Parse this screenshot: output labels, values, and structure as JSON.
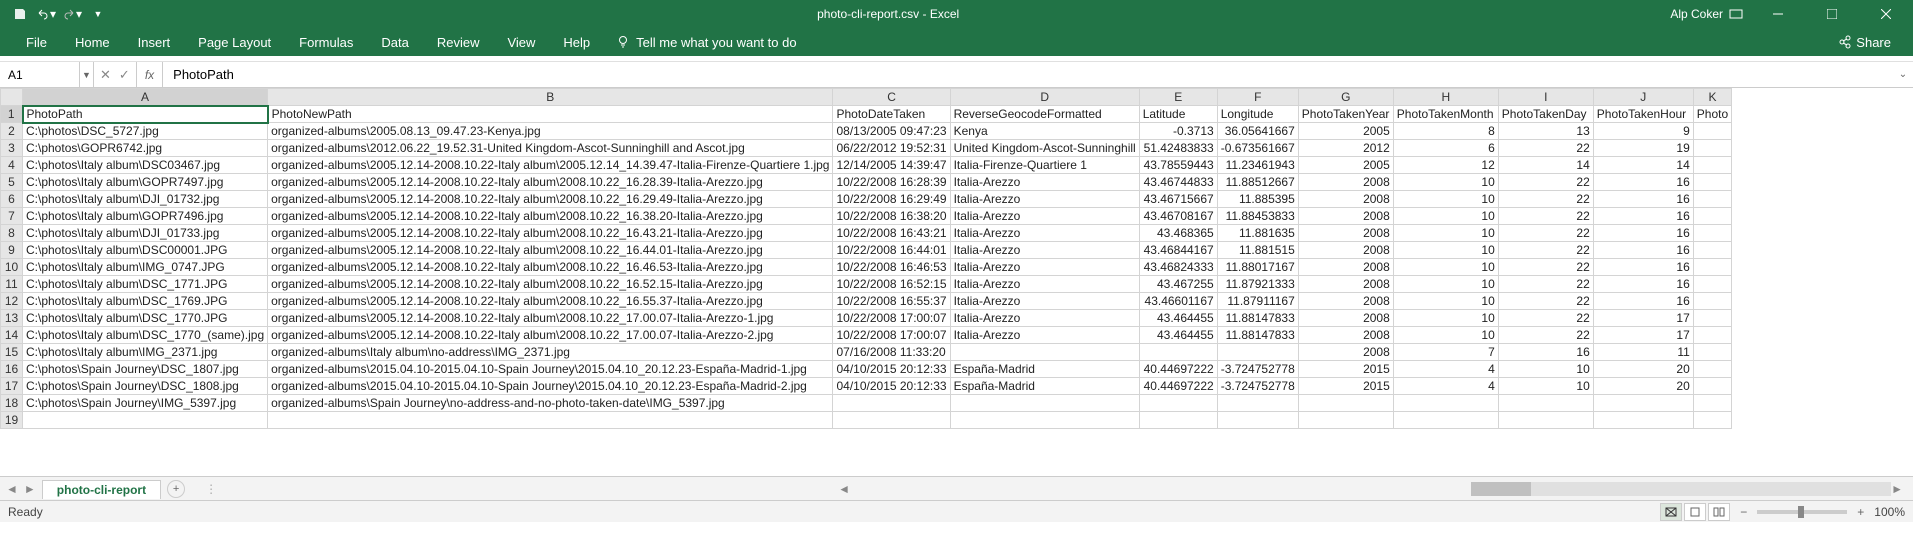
{
  "title": "photo-cli-report.csv - Excel",
  "user": "Alp Coker",
  "ribbon": {
    "file": "File",
    "home": "Home",
    "insert": "Insert",
    "pagelayout": "Page Layout",
    "formulas": "Formulas",
    "data": "Data",
    "review": "Review",
    "view": "View",
    "help": "Help",
    "tellme": "Tell me what you want to do",
    "share": "Share"
  },
  "namebox": "A1",
  "formula": "PhotoPath",
  "sheet_name": "photo-cli-report",
  "status": "Ready",
  "zoom": "100%",
  "columns": [
    "",
    "A",
    "B",
    "C",
    "D",
    "E",
    "F",
    "G",
    "H",
    "I",
    "J",
    "K"
  ],
  "headers": [
    "PhotoPath",
    "PhotoNewPath",
    "PhotoDateTaken",
    "ReverseGeocodeFormatted",
    "Latitude",
    "Longitude",
    "PhotoTakenYear",
    "PhotoTakenMonth",
    "PhotoTakenDay",
    "PhotoTakenHour",
    "Photo"
  ],
  "rows": [
    [
      "C:\\photos\\DSC_5727.jpg",
      "organized-albums\\2005.08.13_09.47.23-Kenya.jpg",
      "08/13/2005 09:47:23",
      "Kenya",
      "-0.3713",
      "36.05641667",
      "2005",
      "8",
      "13",
      "9",
      ""
    ],
    [
      "C:\\photos\\GOPR6742.jpg",
      "organized-albums\\2012.06.22_19.52.31-United Kingdom-Ascot-Sunninghill and Ascot.jpg",
      "06/22/2012 19:52:31",
      "United Kingdom-Ascot-Sunninghill",
      "51.42483833",
      "-0.673561667",
      "2012",
      "6",
      "22",
      "19",
      ""
    ],
    [
      "C:\\photos\\Italy album\\DSC03467.jpg",
      "organized-albums\\2005.12.14-2008.10.22-Italy album\\2005.12.14_14.39.47-Italia-Firenze-Quartiere 1.jpg",
      "12/14/2005 14:39:47",
      "Italia-Firenze-Quartiere 1",
      "43.78559443",
      "11.23461943",
      "2005",
      "12",
      "14",
      "14",
      ""
    ],
    [
      "C:\\photos\\Italy album\\GOPR7497.jpg",
      "organized-albums\\2005.12.14-2008.10.22-Italy album\\2008.10.22_16.28.39-Italia-Arezzo.jpg",
      "10/22/2008 16:28:39",
      "Italia-Arezzo",
      "43.46744833",
      "11.88512667",
      "2008",
      "10",
      "22",
      "16",
      ""
    ],
    [
      "C:\\photos\\Italy album\\DJI_01732.jpg",
      "organized-albums\\2005.12.14-2008.10.22-Italy album\\2008.10.22_16.29.49-Italia-Arezzo.jpg",
      "10/22/2008 16:29:49",
      "Italia-Arezzo",
      "43.46715667",
      "11.885395",
      "2008",
      "10",
      "22",
      "16",
      ""
    ],
    [
      "C:\\photos\\Italy album\\GOPR7496.jpg",
      "organized-albums\\2005.12.14-2008.10.22-Italy album\\2008.10.22_16.38.20-Italia-Arezzo.jpg",
      "10/22/2008 16:38:20",
      "Italia-Arezzo",
      "43.46708167",
      "11.88453833",
      "2008",
      "10",
      "22",
      "16",
      ""
    ],
    [
      "C:\\photos\\Italy album\\DJI_01733.jpg",
      "organized-albums\\2005.12.14-2008.10.22-Italy album\\2008.10.22_16.43.21-Italia-Arezzo.jpg",
      "10/22/2008 16:43:21",
      "Italia-Arezzo",
      "43.468365",
      "11.881635",
      "2008",
      "10",
      "22",
      "16",
      ""
    ],
    [
      "C:\\photos\\Italy album\\DSC00001.JPG",
      "organized-albums\\2005.12.14-2008.10.22-Italy album\\2008.10.22_16.44.01-Italia-Arezzo.jpg",
      "10/22/2008 16:44:01",
      "Italia-Arezzo",
      "43.46844167",
      "11.881515",
      "2008",
      "10",
      "22",
      "16",
      ""
    ],
    [
      "C:\\photos\\Italy album\\IMG_0747.JPG",
      "organized-albums\\2005.12.14-2008.10.22-Italy album\\2008.10.22_16.46.53-Italia-Arezzo.jpg",
      "10/22/2008 16:46:53",
      "Italia-Arezzo",
      "43.46824333",
      "11.88017167",
      "2008",
      "10",
      "22",
      "16",
      ""
    ],
    [
      "C:\\photos\\Italy album\\DSC_1771.JPG",
      "organized-albums\\2005.12.14-2008.10.22-Italy album\\2008.10.22_16.52.15-Italia-Arezzo.jpg",
      "10/22/2008 16:52:15",
      "Italia-Arezzo",
      "43.467255",
      "11.87921333",
      "2008",
      "10",
      "22",
      "16",
      ""
    ],
    [
      "C:\\photos\\Italy album\\DSC_1769.JPG",
      "organized-albums\\2005.12.14-2008.10.22-Italy album\\2008.10.22_16.55.37-Italia-Arezzo.jpg",
      "10/22/2008 16:55:37",
      "Italia-Arezzo",
      "43.46601167",
      "11.87911167",
      "2008",
      "10",
      "22",
      "16",
      ""
    ],
    [
      "C:\\photos\\Italy album\\DSC_1770.JPG",
      "organized-albums\\2005.12.14-2008.10.22-Italy album\\2008.10.22_17.00.07-Italia-Arezzo-1.jpg",
      "10/22/2008 17:00:07",
      "Italia-Arezzo",
      "43.464455",
      "11.88147833",
      "2008",
      "10",
      "22",
      "17",
      ""
    ],
    [
      "C:\\photos\\Italy album\\DSC_1770_(same).jpg",
      "organized-albums\\2005.12.14-2008.10.22-Italy album\\2008.10.22_17.00.07-Italia-Arezzo-2.jpg",
      "10/22/2008 17:00:07",
      "Italia-Arezzo",
      "43.464455",
      "11.88147833",
      "2008",
      "10",
      "22",
      "17",
      ""
    ],
    [
      "C:\\photos\\Italy album\\IMG_2371.jpg",
      "organized-albums\\Italy album\\no-address\\IMG_2371.jpg",
      "07/16/2008 11:33:20",
      "",
      "",
      "",
      "2008",
      "7",
      "16",
      "11",
      ""
    ],
    [
      "C:\\photos\\Spain Journey\\DSC_1807.jpg",
      "organized-albums\\2015.04.10-2015.04.10-Spain Journey\\2015.04.10_20.12.23-España-Madrid-1.jpg",
      "04/10/2015 20:12:33",
      "España-Madrid",
      "40.44697222",
      "-3.724752778",
      "2015",
      "4",
      "10",
      "20",
      ""
    ],
    [
      "C:\\photos\\Spain Journey\\DSC_1808.jpg",
      "organized-albums\\2015.04.10-2015.04.10-Spain Journey\\2015.04.10_20.12.23-España-Madrid-2.jpg",
      "04/10/2015 20:12:33",
      "España-Madrid",
      "40.44697222",
      "-3.724752778",
      "2015",
      "4",
      "10",
      "20",
      ""
    ],
    [
      "C:\\photos\\Spain Journey\\IMG_5397.jpg",
      "organized-albums\\Spain Journey\\no-address-and-no-photo-taken-date\\IMG_5397.jpg",
      "",
      "",
      "",
      "",
      "",
      "",
      "",
      "",
      ""
    ]
  ]
}
